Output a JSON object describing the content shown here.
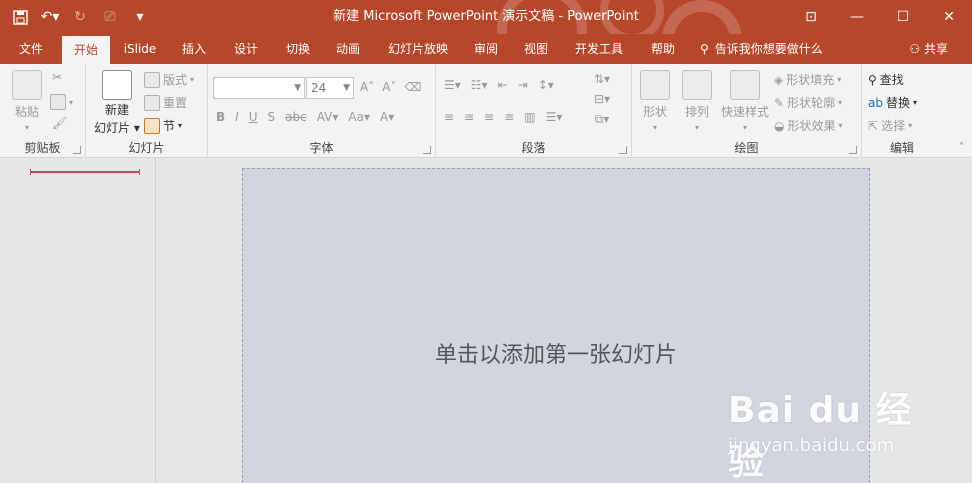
{
  "window": {
    "title": "新建 Microsoft PowerPoint 演示文稿  -  PowerPoint"
  },
  "tabs": [
    {
      "label": "文件"
    },
    {
      "label": "开始",
      "active": true
    },
    {
      "label": "iSlide"
    },
    {
      "label": "插入"
    },
    {
      "label": "设计"
    },
    {
      "label": "切换"
    },
    {
      "label": "动画"
    },
    {
      "label": "幻灯片放映"
    },
    {
      "label": "审阅"
    },
    {
      "label": "视图"
    },
    {
      "label": "开发工具"
    },
    {
      "label": "帮助"
    }
  ],
  "tell_me": "告诉我你想要做什么",
  "share": "共享",
  "ribbon": {
    "clipboard": {
      "paste": "粘贴",
      "group": "剪贴板"
    },
    "slides": {
      "new_slide_line1": "新建",
      "new_slide_line2": "幻灯片",
      "layout": "版式",
      "reset": "重置",
      "section": "节",
      "group": "幻灯片"
    },
    "font": {
      "name": "",
      "size": "24",
      "group": "字体"
    },
    "paragraph": {
      "group": "段落"
    },
    "drawing": {
      "shapes": "形状",
      "arrange": "排列",
      "quick_styles": "快速样式",
      "fill": "形状填充",
      "outline": "形状轮廓",
      "effects": "形状效果",
      "group": "绘图"
    },
    "editing": {
      "find": "查找",
      "replace": "替换",
      "select": "选择",
      "group": "编辑"
    }
  },
  "slide": {
    "hint": "单击以添加第一张幻灯片"
  },
  "watermark": {
    "main": "Bai du 经验",
    "sub": "jingyan.baidu.com"
  },
  "colors": {
    "accent": "#b7472a",
    "ribbon": "#f3f3f3",
    "slide": "#d1d5de"
  }
}
